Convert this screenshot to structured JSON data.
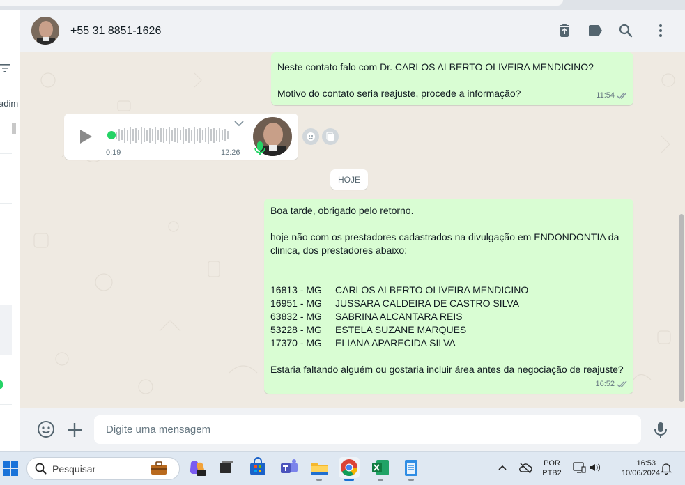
{
  "contact": {
    "name": "+55 31 8851-1626"
  },
  "sidebar": {
    "partial_text": "adim"
  },
  "messages": {
    "out1": {
      "line1": "Neste contato falo com Dr. CARLOS ALBERTO OLIVEIRA MENDICINO?",
      "line2": "Motivo do contato seria reajuste, procede a informação?",
      "time": "11:54"
    },
    "audio": {
      "duration": "0:19",
      "time": "12:26"
    },
    "day_separator": "HOJE",
    "out2": {
      "greeting": "Boa tarde, obrigado pelo retorno.",
      "para1_line1": "hoje não com os prestadores cadastrados na divulgação em ENDONDONTIA da",
      "para1_line2": "clinica, dos prestadores abaixo:",
      "providers": [
        {
          "code": "16813 - MG",
          "name": "CARLOS ALBERTO OLIVEIRA MENDICINO"
        },
        {
          "code": "16951 - MG",
          "name": "JUSSARA CALDEIRA DE CASTRO SILVA"
        },
        {
          "code": "63832 - MG",
          "name": "SABRINA ALCANTARA REIS"
        },
        {
          "code": "53228 - MG",
          "name": "ESTELA SUZANE MARQUES"
        },
        {
          "code": "17370 - MG",
          "name": "ELIANA APARECIDA SILVA"
        }
      ],
      "closing": "Estaria faltando alguém ou gostaria incluir área antes da negociação de reajuste?",
      "time": "16:52"
    }
  },
  "composer": {
    "placeholder": "Digite uma mensagem"
  },
  "taskbar": {
    "search_placeholder": "Pesquisar",
    "language_line1": "POR",
    "language_line2": "PTB2",
    "time": "16:53",
    "date": "10/06/2024"
  },
  "icons": {
    "header": [
      "delete-icon",
      "label-icon",
      "search-icon",
      "menu-icon"
    ],
    "composer": [
      "emoji-icon",
      "attach-icon",
      "mic-icon"
    ]
  },
  "colors": {
    "outgoing_bubble": "#d9fdd3",
    "incoming_bubble": "#ffffff",
    "chat_background": "#efeae2",
    "accent_green": "#25d366"
  }
}
